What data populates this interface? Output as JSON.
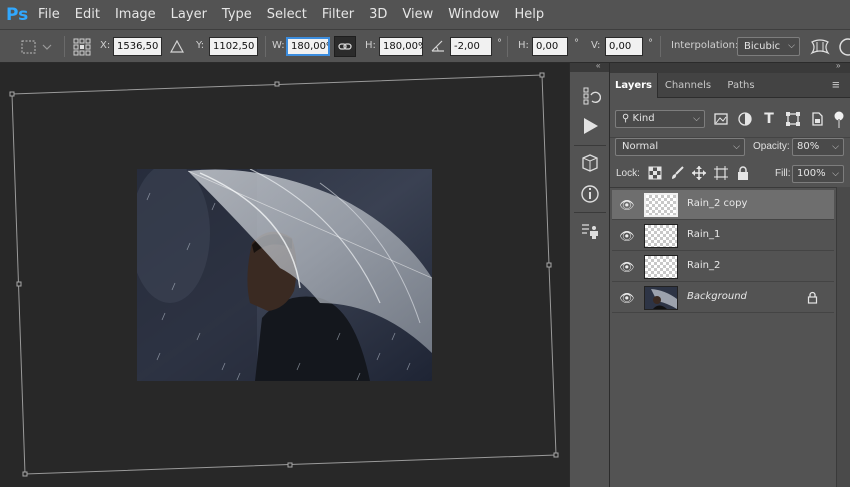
{
  "app": {
    "logo": "Ps"
  },
  "menu": [
    "File",
    "Edit",
    "Image",
    "Layer",
    "Type",
    "Select",
    "Filter",
    "3D",
    "View",
    "Window",
    "Help"
  ],
  "options": {
    "x_label": "X:",
    "x_value": "1536,50 px",
    "y_label": "Y:",
    "y_value": "1102,50 px",
    "w_label": "W:",
    "w_value": "180,00%",
    "h_label": "H:",
    "h_value": "180,00%",
    "angle_value": "-2,00",
    "angle_unit": "°",
    "hskew_label": "H:",
    "hskew_value": "0,00",
    "hskew_unit": "°",
    "vskew_label": "V:",
    "vskew_value": "0,00",
    "vskew_unit": "°",
    "interp_label": "Interpolation:",
    "interp_value": "Bicubic"
  },
  "panel": {
    "tabs": [
      "Layers",
      "Channels",
      "Paths"
    ],
    "active_tab": "Layers",
    "filter_kind": "Kind",
    "blend_mode": "Normal",
    "opacity_label": "Opacity:",
    "opacity_value": "80%",
    "lock_label": "Lock:",
    "fill_label": "Fill:",
    "fill_value": "100%",
    "layers": [
      {
        "name": "Rain_2 copy",
        "selected": true
      },
      {
        "name": "Rain_1",
        "selected": false
      },
      {
        "name": "Rain_2",
        "selected": false
      },
      {
        "name": "Background",
        "selected": false,
        "locked": true
      }
    ]
  },
  "colors": {
    "accent": "#31a8ff",
    "panel_bg": "#535353",
    "canvas_bg": "#282828"
  }
}
